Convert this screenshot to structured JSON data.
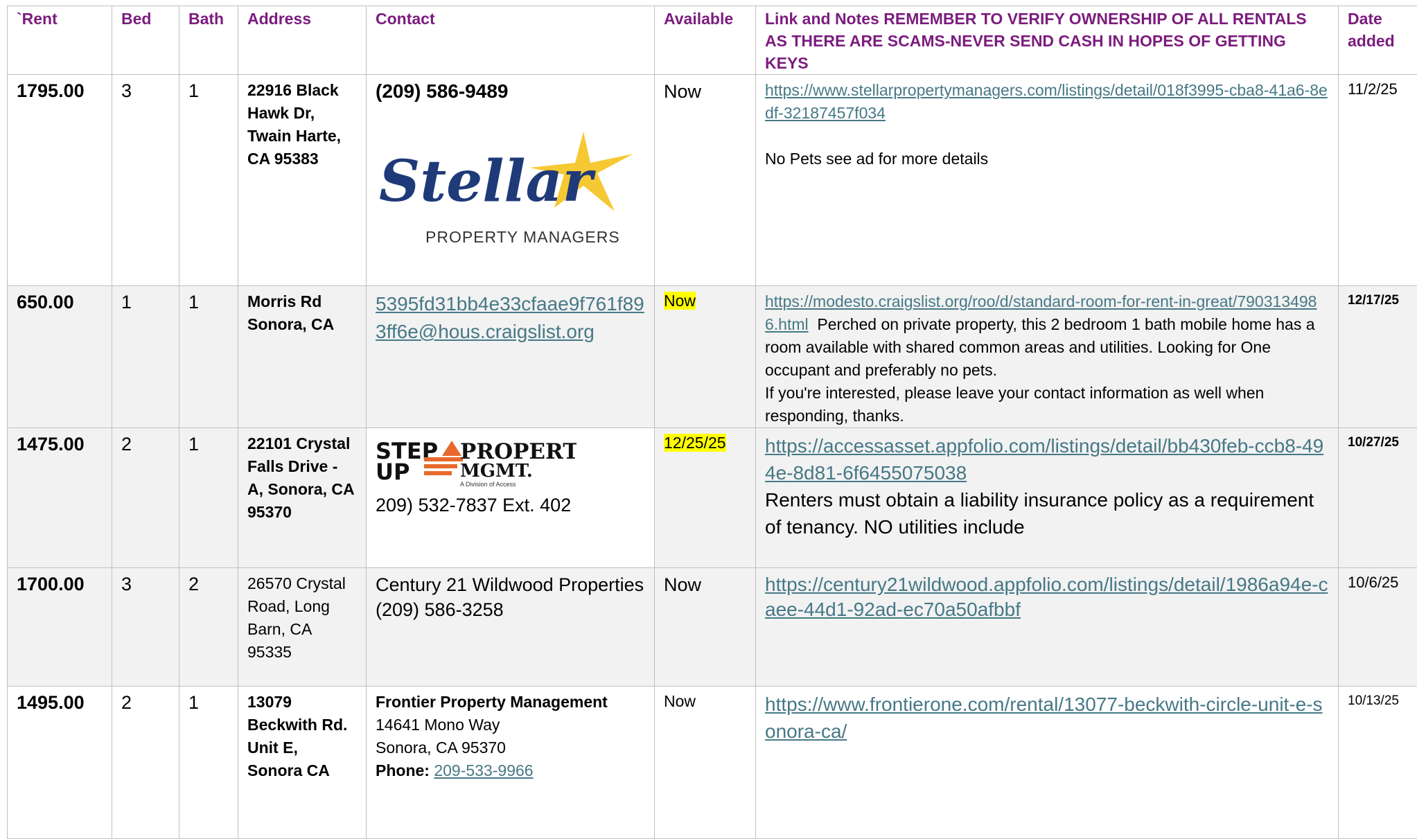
{
  "headers": {
    "rent": "`Rent",
    "bed": "Bed",
    "bath": "Bath",
    "address": "Address",
    "contact": "Contact",
    "available": "Available",
    "notes": "Link and Notes REMEMBER TO VERIFY OWNERSHIP OF ALL RENTALS AS THERE ARE SCAMS-NEVER SEND CASH IN HOPES OF GETTING KEYS",
    "date": "Date added"
  },
  "rows": [
    {
      "rent": "1795.00",
      "bed": "3",
      "bath": "1",
      "address": "22916 Black Hawk Dr, Twain Harte, CA 95383",
      "contact_phone": "(209) 586-9489",
      "logo_text": "Stellar",
      "logo_subtext": "PROPERTY MANAGERS",
      "available": "Now",
      "link": "https://www.stellarpropertymanagers.com/listings/detail/018f3995-cba8-41a6-8edf-32187457f034",
      "note": "No Pets see ad for more details",
      "date": "11/2/25"
    },
    {
      "rent": "650.00",
      "bed": "1",
      "bath": "1",
      "address_line1": "Morris Rd",
      "address_line2": "Sonora, CA",
      "contact_email": "5395fd31bb4e33cfaae9f761f893ff6e@hous.craigslist.org",
      "available": "Now",
      "link": "https://modesto.craigslist.org/roo/d/standard-room-for-rent-in-great/7903134986.html",
      "note": "Perched on private property, this 2 bedroom 1 bath mobile home has a room available with shared common areas and utilities. Looking for One occupant and preferably no pets.",
      "note2": "If you're interested, please leave your contact information as well when responding, thanks.",
      "date": "12/17/25"
    },
    {
      "rent": "1475.00",
      "bed": "2",
      "bath": "1",
      "address": "22101 Crystal Falls Drive - A, Sonora, CA 95370",
      "logo_text_1": "STEP",
      "logo_text_2": "UP",
      "logo_text_3": "PROPERTY",
      "logo_text_4": "MGMT.",
      "logo_text_5": "A Division of Access",
      "contact_phone": "209) 532-7837 Ext. 402",
      "available": "12/25/25",
      "link": "https://accessasset.appfolio.com/listings/detail/bb430feb-ccb8-494e-8d81-6f6455075038",
      "note": "Renters must obtain a liability insurance policy as a requirement of tenancy. NO utilities include",
      "date": "10/27/25"
    },
    {
      "rent": "1700.00",
      "bed": "3",
      "bath": "2",
      "address": "26570 Crystal Road, Long Barn, CA 95335",
      "contact_name": "Century 21 Wildwood Properties",
      "contact_phone": "(209) 586-3258",
      "available": "Now",
      "link": "https://century21wildwood.appfolio.com/listings/detail/1986a94e-caee-44d1-92ad-ec70a50afbbf",
      "date": "10/6/25"
    },
    {
      "rent": "1495.00",
      "bed": "2",
      "bath": "1",
      "address": "13079 Beckwith Rd. Unit E, Sonora CA",
      "contact_name": "Frontier Property Management",
      "contact_street": "14641 Mono Way",
      "contact_city": "Sonora, CA 95370",
      "contact_phone_label": "Phone:",
      "contact_phone": "209-533-9966",
      "available": "Now",
      "link": "https://www.frontierone.com/rental/13077-beckwith-circle-unit-e-sonora-ca/",
      "date": "10/13/25"
    }
  ],
  "colors": {
    "header_text": "#7b1c7e",
    "link": "#467886",
    "highlight": "#ffff00",
    "row_gray": "#f2f2f2",
    "stellar_blue": "#1f3a78",
    "stellar_star": "#f6c833",
    "stepup_orange": "#e8692b"
  }
}
